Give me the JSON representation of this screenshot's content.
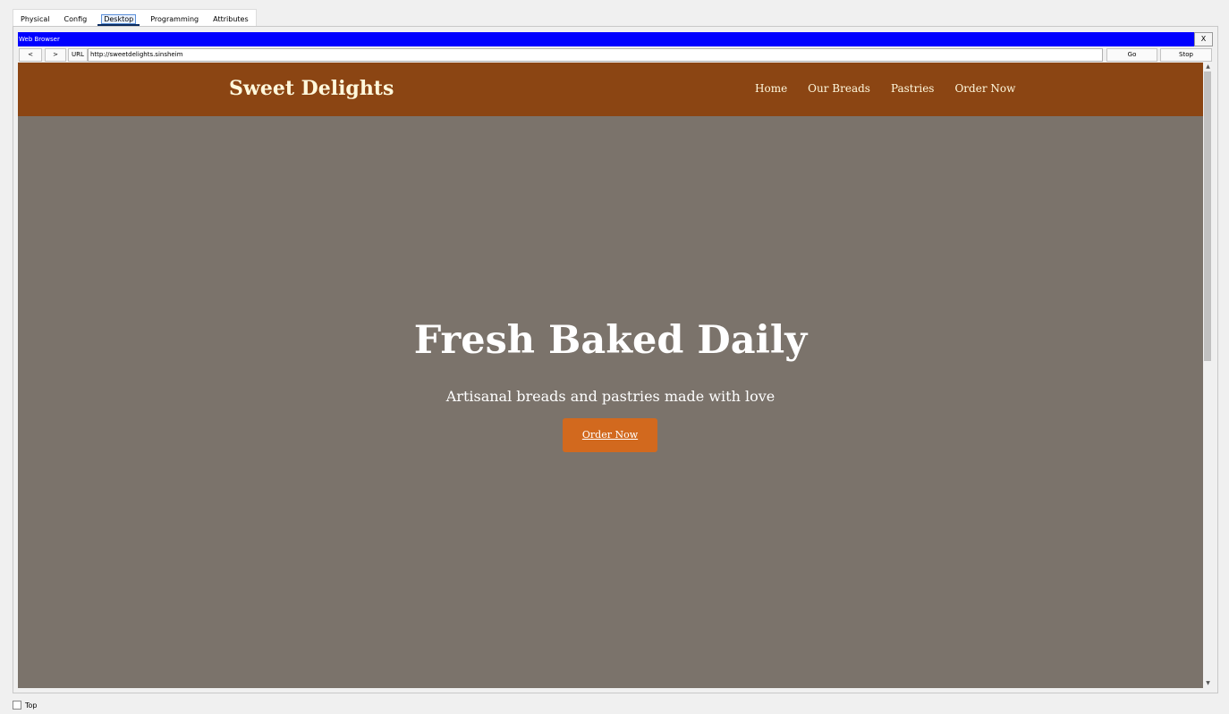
{
  "tabs": [
    {
      "label": "Physical"
    },
    {
      "label": "Config"
    },
    {
      "label": "Desktop"
    },
    {
      "label": "Programming"
    },
    {
      "label": "Attributes"
    }
  ],
  "window": {
    "title": "Web Browser",
    "close_label": "X"
  },
  "toolbar": {
    "back_label": "<",
    "forward_label": ">",
    "url_label": "URL",
    "url_value": "http://sweetdelights.sinsheim",
    "go_label": "Go",
    "stop_label": "Stop"
  },
  "site": {
    "brand": "Sweet Delights",
    "menu": [
      "Home",
      "Our Breads",
      "Pastries",
      "Order Now"
    ],
    "hero_title": "Fresh Baked Daily",
    "hero_subtitle": "Artisanal breads and pastries made with love",
    "cta_label": "Order Now"
  },
  "bottom": {
    "top_label": "Top"
  },
  "colors": {
    "titlebar": "#0000ff",
    "site_header": "#8b4513",
    "hero_bg": "#7b736b",
    "cta": "#d2691e"
  }
}
